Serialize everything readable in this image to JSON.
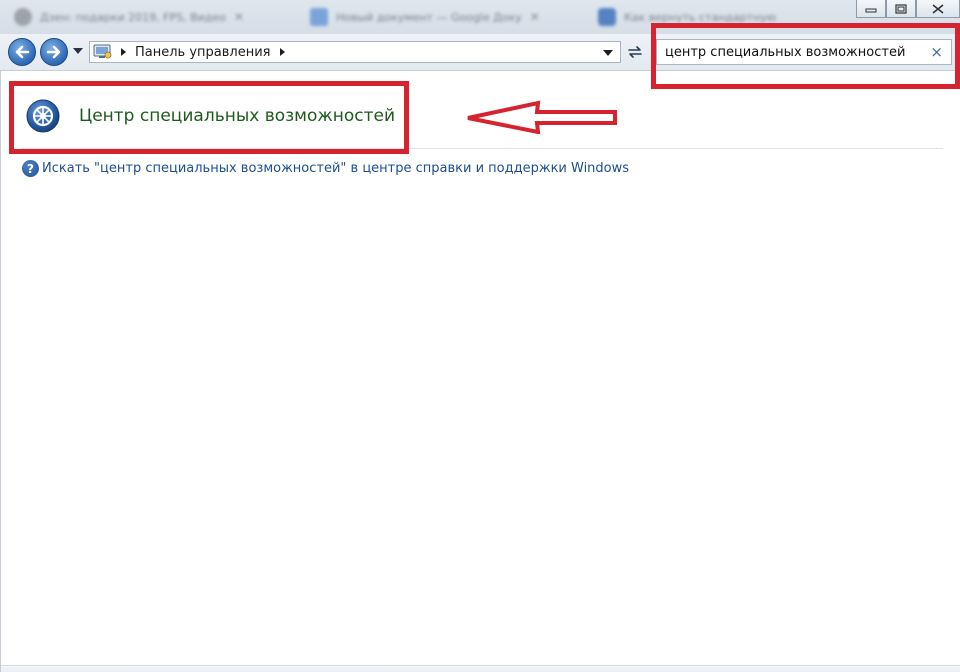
{
  "browser_tabs": [
    {
      "title": "Дзен: подарки 2019, FPS, Видео"
    },
    {
      "title": "Новый документ — Google Доку"
    },
    {
      "title": "Как вернуть стандартную"
    }
  ],
  "window_controls": {
    "minimize": "▭",
    "maximize": "◻",
    "close": "✕"
  },
  "address_bar": {
    "breadcrumb": "Панель управления"
  },
  "search": {
    "value": "центр специальных возможностей",
    "clear_glyph": "×"
  },
  "results": {
    "main_title": "Центр специальных возможностей",
    "help_icon_glyph": "?",
    "help_link": "Искать \"центр специальных возможностей\" в центре справки и поддержки Windows"
  },
  "colors": {
    "annotation_red": "#d6232f",
    "result_title_green": "#1e5a1e",
    "link_blue": "#1d4f91",
    "nav_button_blue": "#2d68b3"
  },
  "icons": {
    "back": "back-arrow-icon",
    "forward": "forward-arrow-icon",
    "recent_pages": "chevron-down-icon",
    "control_panel": "control-panel-icon",
    "refresh": "refresh-icon",
    "ease_of_access": "ease-of-access-icon",
    "help": "help-icon"
  }
}
